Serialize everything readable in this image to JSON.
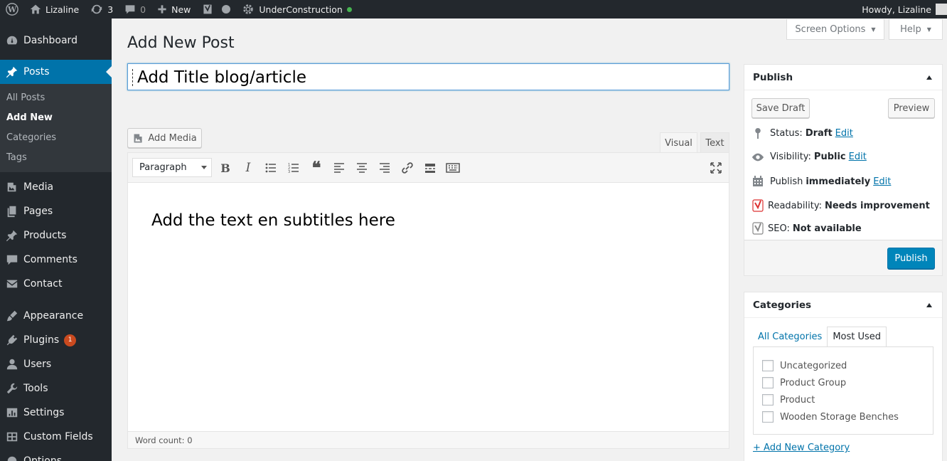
{
  "adminbar": {
    "site_name": "Lizaline",
    "updates_count": "3",
    "comments_count": "0",
    "new_label": "New",
    "plugin_label": "UnderConstruction",
    "howdy": "Howdy, Lizaline"
  },
  "sidebar": {
    "items": [
      {
        "label": "Dashboard",
        "icon": "dashboard-icon"
      },
      {
        "label": "Posts",
        "icon": "pin-icon"
      },
      {
        "label": "Media",
        "icon": "media-icon"
      },
      {
        "label": "Pages",
        "icon": "pages-icon"
      },
      {
        "label": "Products",
        "icon": "pin-icon"
      },
      {
        "label": "Comments",
        "icon": "comment-icon"
      },
      {
        "label": "Contact",
        "icon": "mail-icon"
      },
      {
        "label": "Appearance",
        "icon": "brush-icon"
      },
      {
        "label": "Plugins",
        "icon": "plug-icon",
        "badge": "1"
      },
      {
        "label": "Users",
        "icon": "user-icon"
      },
      {
        "label": "Tools",
        "icon": "wrench-icon"
      },
      {
        "label": "Settings",
        "icon": "settings-icon"
      },
      {
        "label": "Custom Fields",
        "icon": "grid-icon"
      },
      {
        "label": "Options",
        "icon": "gear-icon"
      }
    ],
    "posts_submenu": [
      "All Posts",
      "Add New",
      "Categories",
      "Tags"
    ]
  },
  "screen_options": "Screen Options",
  "help": "Help",
  "page_title": "Add New Post",
  "post_title": "Add Title blog/article",
  "add_media": "Add Media",
  "editor": {
    "tab_visual": "Visual",
    "tab_text": "Text",
    "format": "Paragraph",
    "content": "Add the text en subtitles here",
    "word_count": "Word count: 0"
  },
  "publish_box": {
    "title": "Publish",
    "save_draft": "Save Draft",
    "preview": "Preview",
    "status_label": "Status:",
    "status_value": "Draft",
    "visibility_label": "Visibility:",
    "visibility_value": "Public",
    "publish_label": "Publish",
    "publish_value": "immediately",
    "readability_label": "Readability:",
    "readability_value": "Needs improvement",
    "seo_label": "SEO:",
    "seo_value": "Not available",
    "edit": "Edit",
    "publish_button": "Publish"
  },
  "categories_box": {
    "title": "Categories",
    "tab_all": "All Categories",
    "tab_most_used": "Most Used",
    "items": [
      "Uncategorized",
      "Product Group",
      "Product",
      "Wooden Storage Benches"
    ],
    "add_new": "+ Add New Category"
  },
  "colors": {
    "admin_dark": "#23282d",
    "accent_blue": "#0073aa",
    "publish_blue": "#0085ba",
    "badge_orange": "#ca4a1f",
    "online_green": "#46b450"
  }
}
